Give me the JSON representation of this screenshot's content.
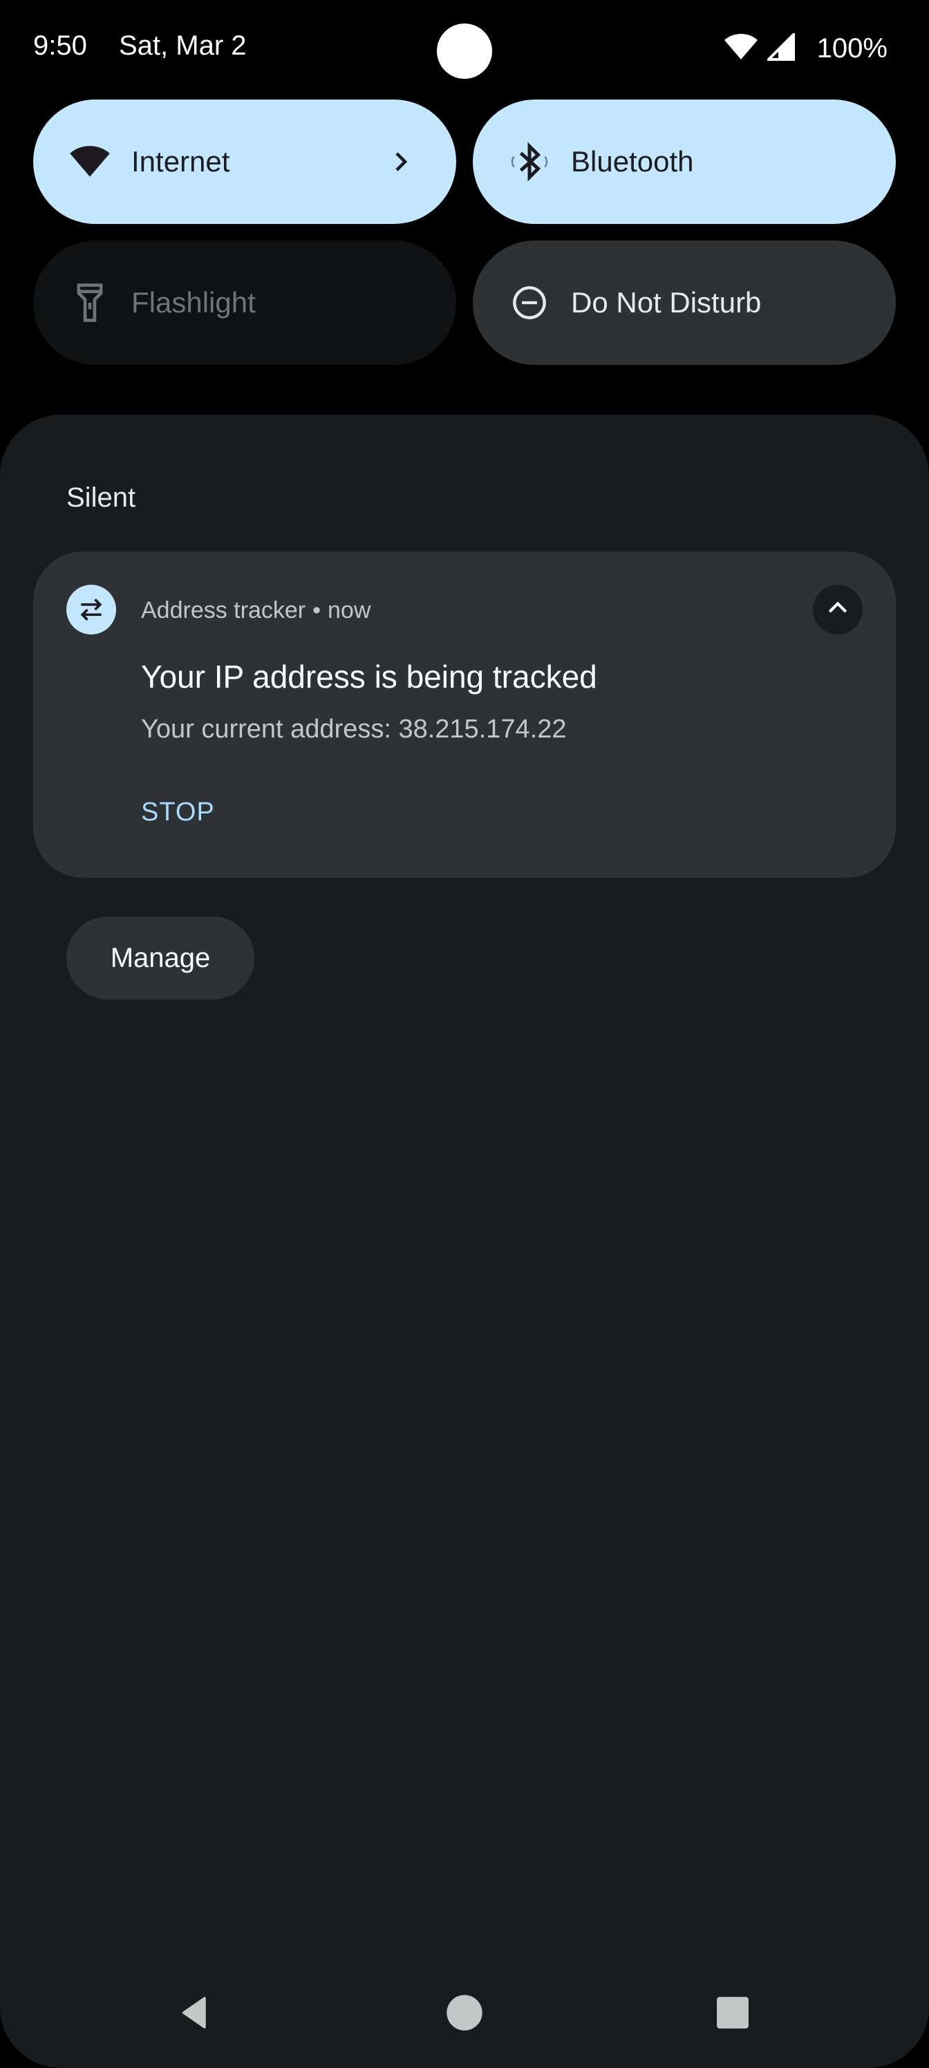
{
  "status_bar": {
    "time": "9:50",
    "date": "Sat, Mar 2",
    "battery": "100%",
    "icons": [
      "wifi-icon",
      "cellular-signal-icon"
    ]
  },
  "quick_settings": {
    "tiles": [
      {
        "label": "Internet",
        "icon": "wifi-icon",
        "state": "on",
        "has_chevron": true
      },
      {
        "label": "Bluetooth",
        "icon": "bluetooth-icon",
        "state": "on"
      },
      {
        "label": "Flashlight",
        "icon": "flashlight-icon",
        "state": "unavailable"
      },
      {
        "label": "Do Not Disturb",
        "icon": "do-not-disturb-icon",
        "state": "off"
      }
    ]
  },
  "notifications": {
    "section_label": "Silent",
    "items": [
      {
        "app_name": "Address tracker",
        "separator": "•",
        "time": "now",
        "title": "Your IP address is being tracked",
        "text": "Your current address: 38.215.174.22",
        "action": "STOP",
        "icon": "swap-arrows-icon"
      }
    ],
    "manage_label": "Manage"
  },
  "navigation": [
    "back-icon",
    "home-icon",
    "recents-icon"
  ],
  "colors": {
    "tile_on": "#c2e7ff",
    "shade_bg": "#191c1f",
    "card_bg": "#2e3235",
    "action_text": "#a8dcff"
  }
}
